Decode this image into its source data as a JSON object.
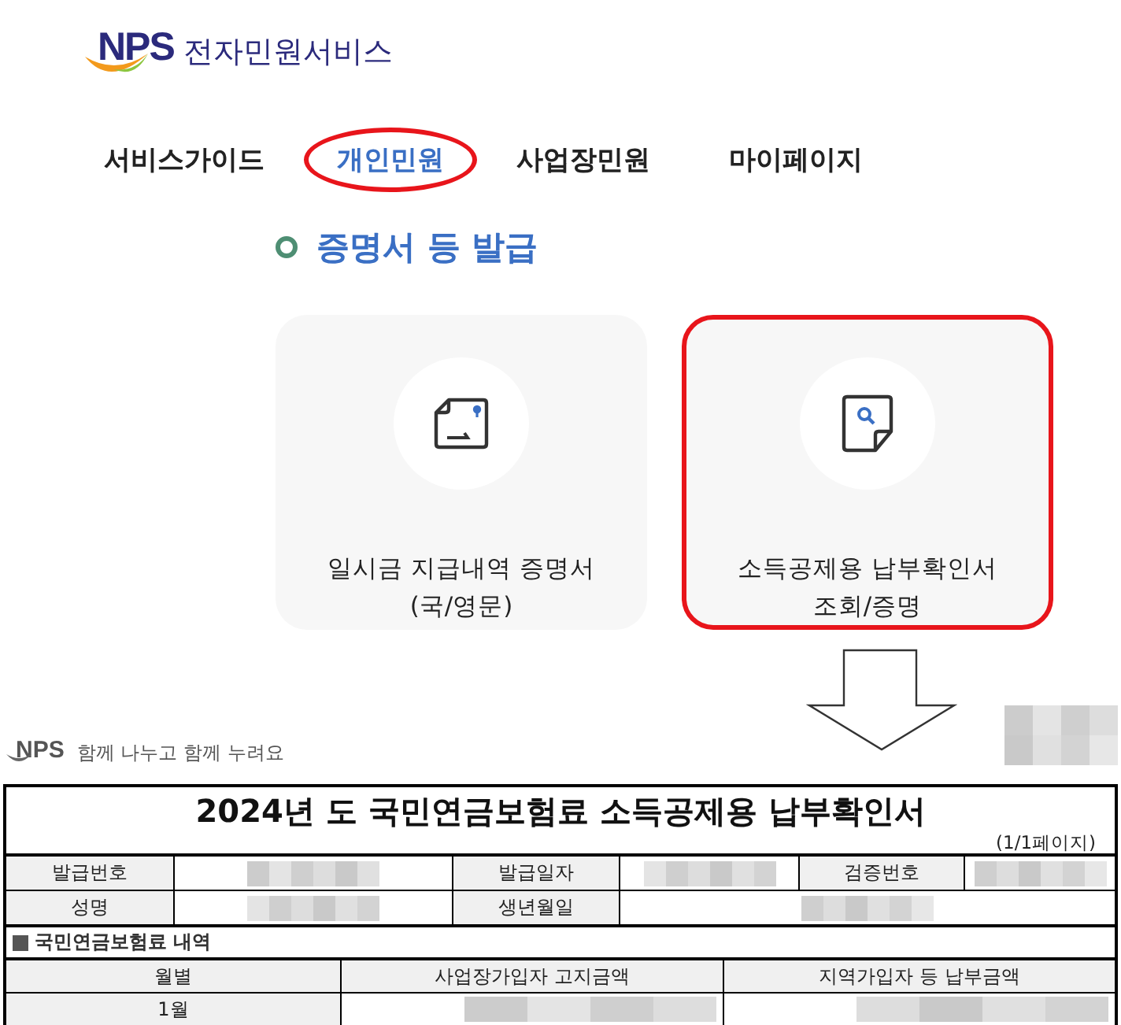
{
  "header": {
    "logo": "NPS",
    "title": "전자민원서비스"
  },
  "nav": [
    {
      "label": "서비스가이드",
      "selected": false
    },
    {
      "label": "개인민원",
      "selected": true
    },
    {
      "label": "사업장민원",
      "selected": false
    },
    {
      "label": "마이페이지",
      "selected": false
    }
  ],
  "section": {
    "title": "증명서 등 발급"
  },
  "cards": [
    {
      "kind": "certificate",
      "lines": [
        "일시금 지급내역 증명서",
        "(국/영문)"
      ],
      "highlighted": false
    },
    {
      "kind": "search",
      "lines": [
        "소득공제용 납부확인서",
        "조회/증명"
      ],
      "highlighted": true
    }
  ],
  "document": {
    "logo": "NPS",
    "slogan": "함께 나누고 함께 누려요",
    "title": "2024년 도 국민연금보험료 소득공제용 납부확인서",
    "page": "(1/1페이지)",
    "info_rows": [
      [
        "발급번호",
        "발급일자",
        "검증번호"
      ],
      [
        "성명",
        "생년월일"
      ]
    ],
    "section": "국민연금보험료 내역",
    "columns": [
      "월별",
      "사업장가입자 고지금액",
      "지역가입자 등 납부금액"
    ],
    "rows": [
      {
        "month": "1월"
      }
    ]
  }
}
